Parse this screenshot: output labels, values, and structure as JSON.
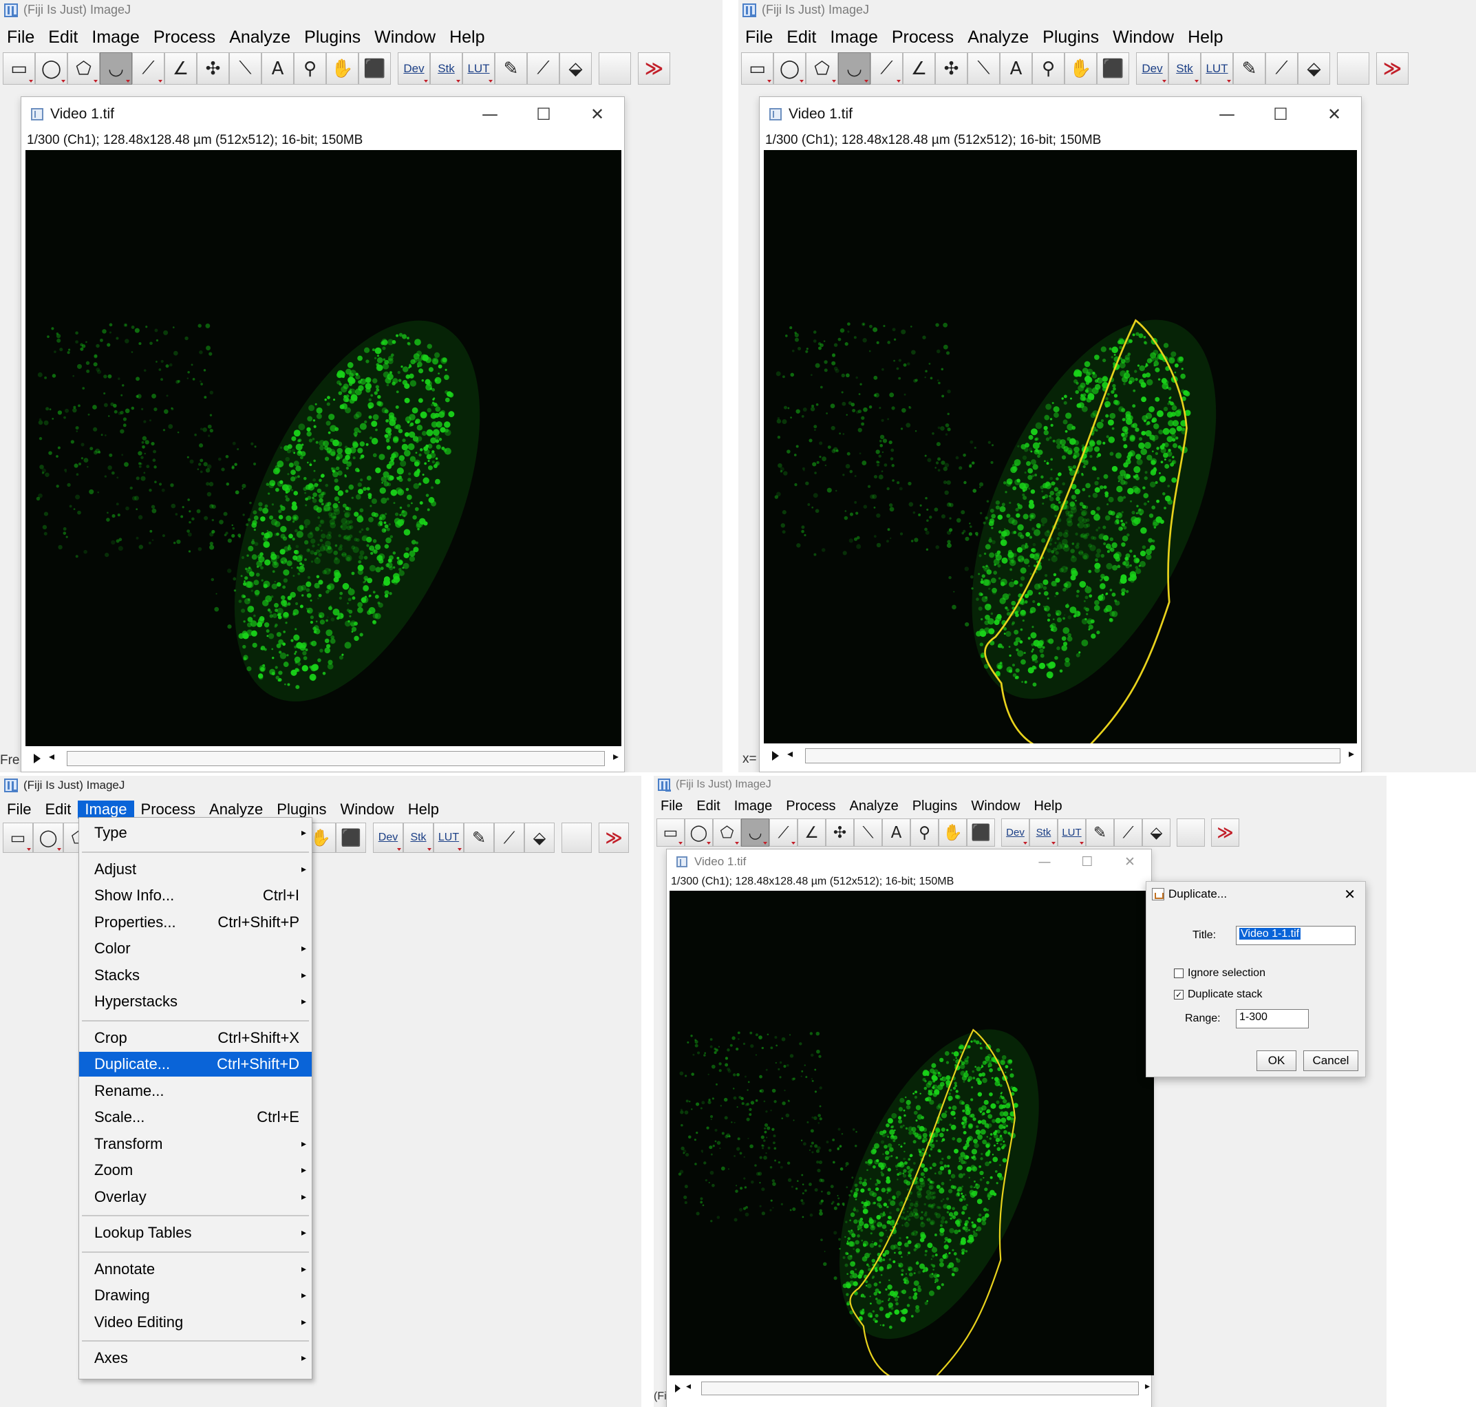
{
  "app": {
    "title": "(Fiji Is Just) ImageJ",
    "menus": [
      "File",
      "Edit",
      "Image",
      "Process",
      "Analyze",
      "Plugins",
      "Window",
      "Help"
    ],
    "toolbar_text_buttons": [
      "Dev",
      "Stk",
      "LUT"
    ],
    "toolbar_icons": [
      "rectangle-tool-icon",
      "oval-tool-icon",
      "polygon-tool-icon",
      "freehand-tool-icon",
      "line-tool-icon",
      "angle-tool-icon",
      "point-tool-icon",
      "wand-tool-icon",
      "text-tool-icon",
      "magnifier-tool-icon",
      "hand-tool-icon",
      "color-picker-icon",
      "dev-icon",
      "stk-icon",
      "lut-icon",
      "pencil-icon",
      "brush-icon",
      "flood-fill-icon",
      "blank-slot",
      "more-tools-icon"
    ]
  },
  "image_window": {
    "title": "Video 1.tif",
    "info": "1/300 (Ch1); 128.48x128.48 µm (512x512); 16-bit; 150MB",
    "controls": {
      "minimize": "—",
      "maximize": "☐",
      "close": "✕"
    }
  },
  "status": {
    "panel1": "Fre",
    "panel2": "x=",
    "panel4": "(Fi"
  },
  "image_menu": {
    "items": [
      {
        "label": "Type",
        "submenu": true
      },
      {
        "label": "Adjust",
        "submenu": true
      },
      {
        "label": "Show Info...",
        "shortcut": "Ctrl+I"
      },
      {
        "label": "Properties...",
        "shortcut": "Ctrl+Shift+P"
      },
      {
        "label": "Color",
        "submenu": true
      },
      {
        "label": "Stacks",
        "submenu": true
      },
      {
        "label": "Hyperstacks",
        "submenu": true
      },
      {
        "label": "Crop",
        "shortcut": "Ctrl+Shift+X"
      },
      {
        "label": "Duplicate...",
        "shortcut": "Ctrl+Shift+D",
        "highlighted": true
      },
      {
        "label": "Rename..."
      },
      {
        "label": "Scale...",
        "shortcut": "Ctrl+E"
      },
      {
        "label": "Transform",
        "submenu": true
      },
      {
        "label": "Zoom",
        "submenu": true
      },
      {
        "label": "Overlay",
        "submenu": true
      },
      {
        "label": "Lookup Tables",
        "submenu": true
      },
      {
        "label": "Annotate",
        "submenu": true
      },
      {
        "label": "Drawing",
        "submenu": true
      },
      {
        "label": "Video Editing",
        "submenu": true
      },
      {
        "label": "Axes",
        "submenu": true
      }
    ],
    "submenu_arrow": "›"
  },
  "duplicate_dialog": {
    "title": "Duplicate...",
    "close": "✕",
    "title_label": "Title:",
    "title_value": "Video 1-1.tif",
    "ignore_selection": {
      "label": "Ignore selection",
      "checked": false
    },
    "duplicate_stack": {
      "label": "Duplicate stack",
      "checked": true
    },
    "range_label": "Range:",
    "range_value": "1-300",
    "ok": "OK",
    "cancel": "Cancel"
  },
  "colors": {
    "selection": "#e8d21c",
    "fluorescence": "#19d219",
    "menu_highlight": "#0a64d8"
  }
}
